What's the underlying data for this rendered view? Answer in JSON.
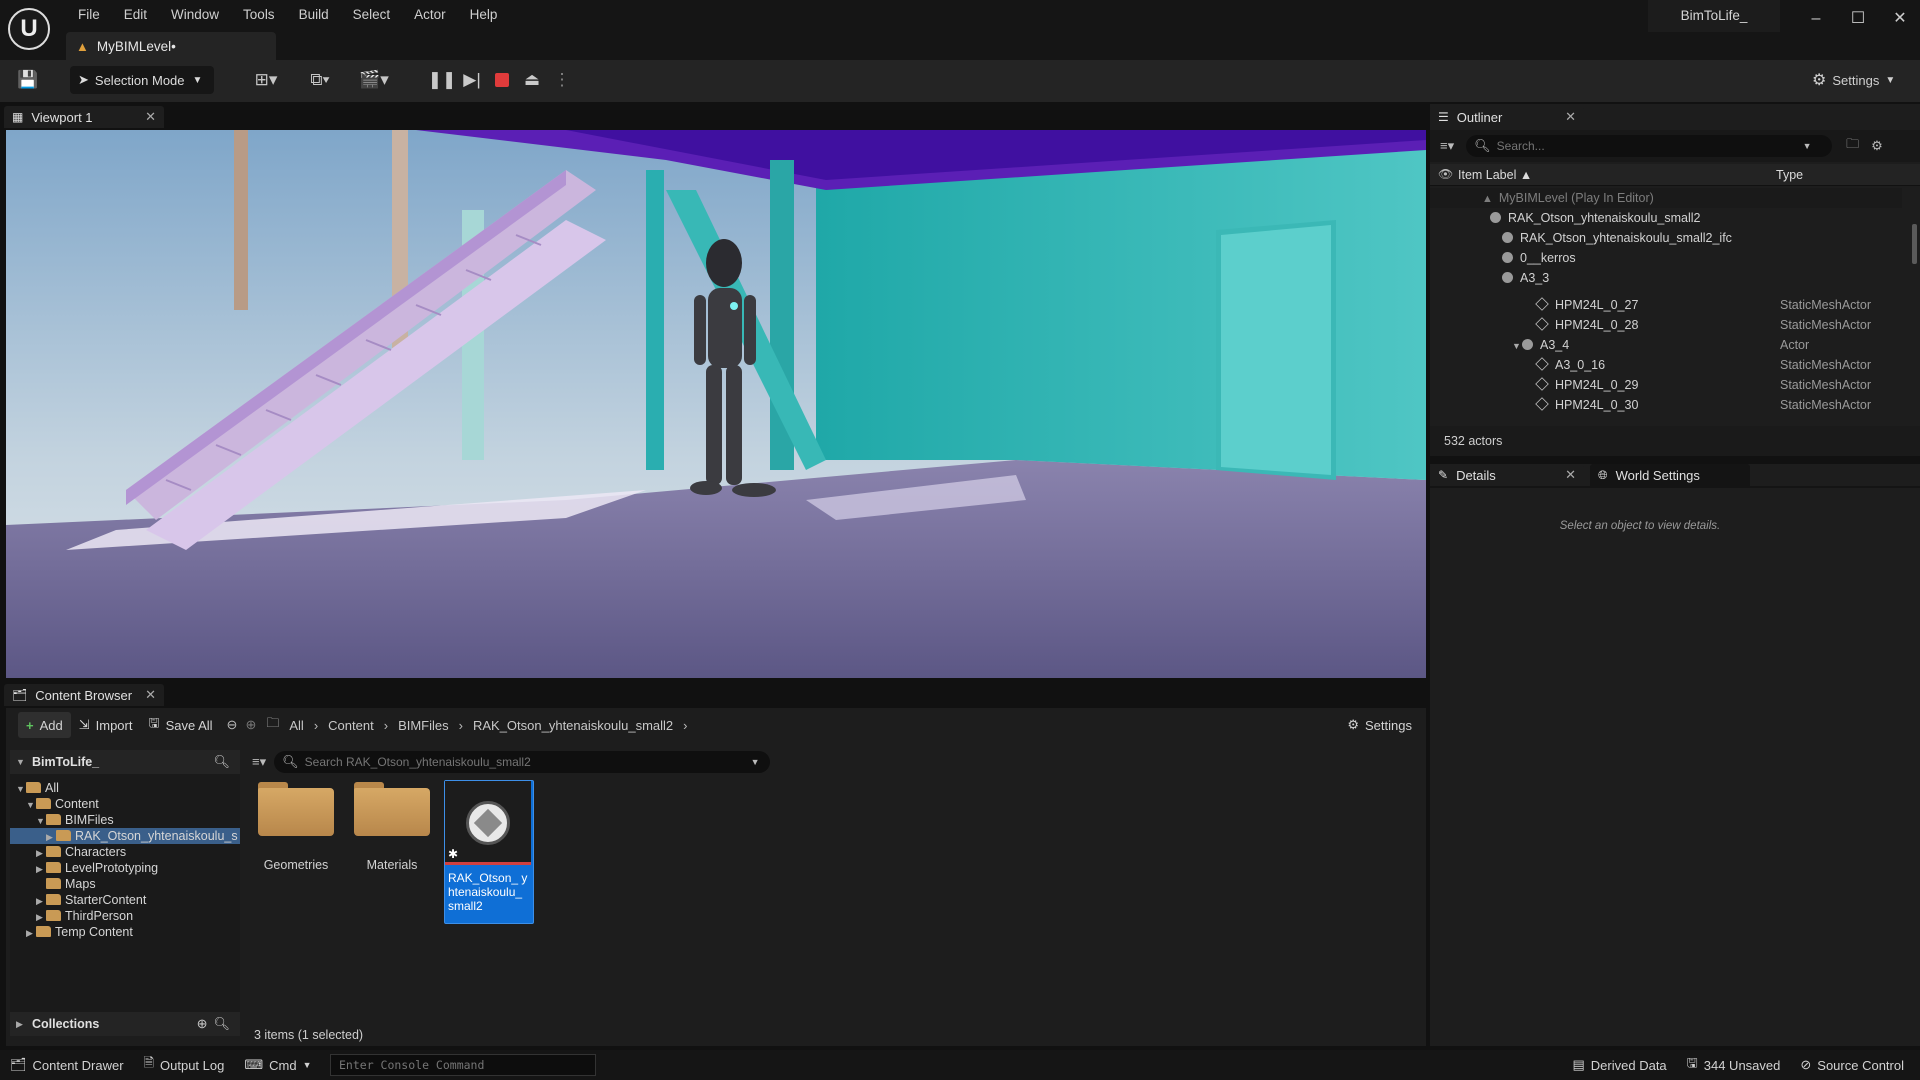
{
  "menu": [
    "File",
    "Edit",
    "Window",
    "Tools",
    "Build",
    "Select",
    "Actor",
    "Help"
  ],
  "level_tab": "MyBIMLevel•",
  "project_name": "BimToLife_",
  "toolbar": {
    "selection_mode": "Selection Mode",
    "settings": "Settings"
  },
  "viewport": {
    "tab_label": "Viewport 1"
  },
  "outliner": {
    "tab_label": "Outliner",
    "search_placeholder": "Search...",
    "col_label": "Item Label ▲",
    "col_type": "Type",
    "rows": [
      {
        "label": "MyBIMLevel (Play In Editor)",
        "type": ""
      },
      {
        "label": "RAK_Otson_yhtenaiskoulu_small2",
        "type": ""
      },
      {
        "label": "RAK_Otson_yhtenaiskoulu_small2_ifc",
        "type": ""
      },
      {
        "label": "0__kerros",
        "type": ""
      },
      {
        "label": "A3_3",
        "type": ""
      },
      {
        "label": "HPM24L_0_27",
        "type": "StaticMeshActor"
      },
      {
        "label": "HPM24L_0_28",
        "type": "StaticMeshActor"
      },
      {
        "label": "A3_4",
        "type": "Actor"
      },
      {
        "label": "A3_0_16",
        "type": "StaticMeshActor"
      },
      {
        "label": "HPM24L_0_29",
        "type": "StaticMeshActor"
      },
      {
        "label": "HPM24L_0_30",
        "type": "StaticMeshActor"
      }
    ],
    "count": "532 actors"
  },
  "details": {
    "tab_label": "Details",
    "world_settings_label": "World Settings",
    "empty_message": "Select an object to view details."
  },
  "content_browser": {
    "tab_label": "Content Browser",
    "add": "Add",
    "import": "Import",
    "save_all": "Save All",
    "breadcrumb": [
      "All",
      "Content",
      "BIMFiles",
      "RAK_Otson_yhtenaiskoulu_small2"
    ],
    "settings": "Settings",
    "search_placeholder": "Search RAK_Otson_yhtenaiskoulu_small2",
    "tree_root": "BimToLife_",
    "tree": [
      "All",
      "Content",
      "BIMFiles",
      "RAK_Otson_yhtenaiskoulu_s",
      "Characters",
      "LevelPrototyping",
      "Maps",
      "StarterContent",
      "ThirdPerson",
      "Temp Content"
    ],
    "collections": "Collections",
    "assets": [
      "Geometries",
      "Materials",
      "RAK_Otson_ yhtenaiskoulu_ small2"
    ],
    "status": "3 items (1 selected)"
  },
  "statusbar": {
    "content_drawer": "Content Drawer",
    "output_log": "Output Log",
    "cmd": "Cmd",
    "console_placeholder": "Enter Console Command",
    "derived_data": "Derived Data",
    "unsaved": "344 Unsaved",
    "source_control": "Source Control"
  },
  "colors": {
    "selection_blue": "#0f6fd6",
    "stop_red": "#e03b3b",
    "folder": "#c99a55"
  }
}
